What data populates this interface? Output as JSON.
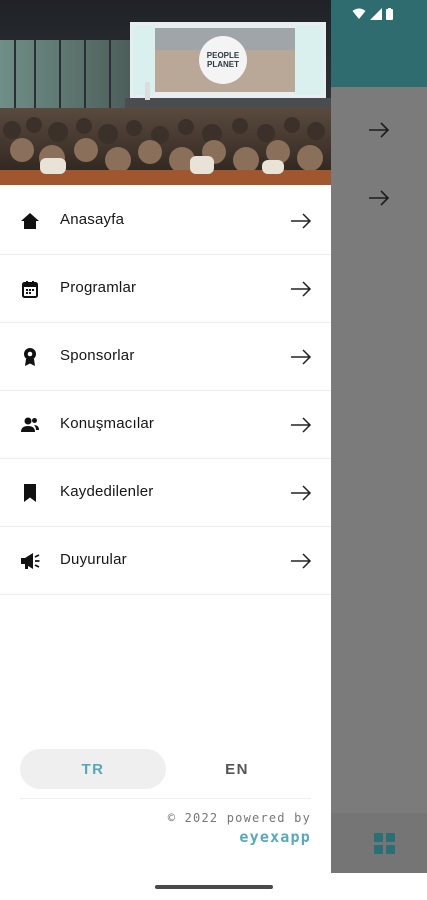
{
  "drawer": {
    "menu": [
      {
        "label": "Anasayfa",
        "icon": "home-icon"
      },
      {
        "label": "Programlar",
        "icon": "calendar-icon"
      },
      {
        "label": "Sponsorlar",
        "icon": "medal-icon"
      },
      {
        "label": "Konuşmacılar",
        "icon": "speakers-icon"
      },
      {
        "label": "Kaydedilenler",
        "icon": "bookmark-icon"
      },
      {
        "label": "Duyurular",
        "icon": "megaphone-icon"
      }
    ],
    "hero_screen_text": {
      "line1": "PEOPLE",
      "line2": "PLANET"
    },
    "language": {
      "active": "TR",
      "other": "EN"
    },
    "copyright": "© 2022 powered by",
    "brand": "eyexapp"
  },
  "colors": {
    "accent": "#5aa7b5",
    "header_teal": "#2f6c70",
    "scrim": "#7b7b7b"
  }
}
